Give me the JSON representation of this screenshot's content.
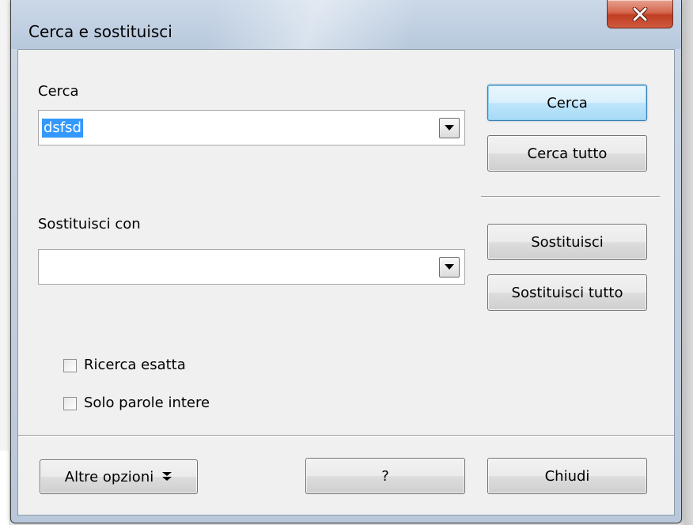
{
  "window": {
    "title": "Cerca e sostituisci"
  },
  "icons": {
    "close": "close-icon",
    "dropdown": "dropdown-arrow-icon",
    "more_options": "double-chevron-down-icon"
  },
  "search": {
    "label": "Cerca",
    "value": "dsfsd",
    "find_button": "Cerca",
    "find_all_button": "Cerca tutto"
  },
  "replace": {
    "label": "Sostituisci con",
    "value": "",
    "replace_button": "Sostituisci",
    "replace_all_button": "Sostituisci tutto"
  },
  "options": {
    "match_case": {
      "label": "Ricerca esatta",
      "checked": false
    },
    "whole_words": {
      "label": "Solo parole intere",
      "checked": false
    }
  },
  "footer": {
    "more_options": "Altre opzioni",
    "help": "?",
    "close": "Chiudi"
  },
  "colors": {
    "selection": "#3399ff",
    "close_button": "#c94a2e"
  }
}
